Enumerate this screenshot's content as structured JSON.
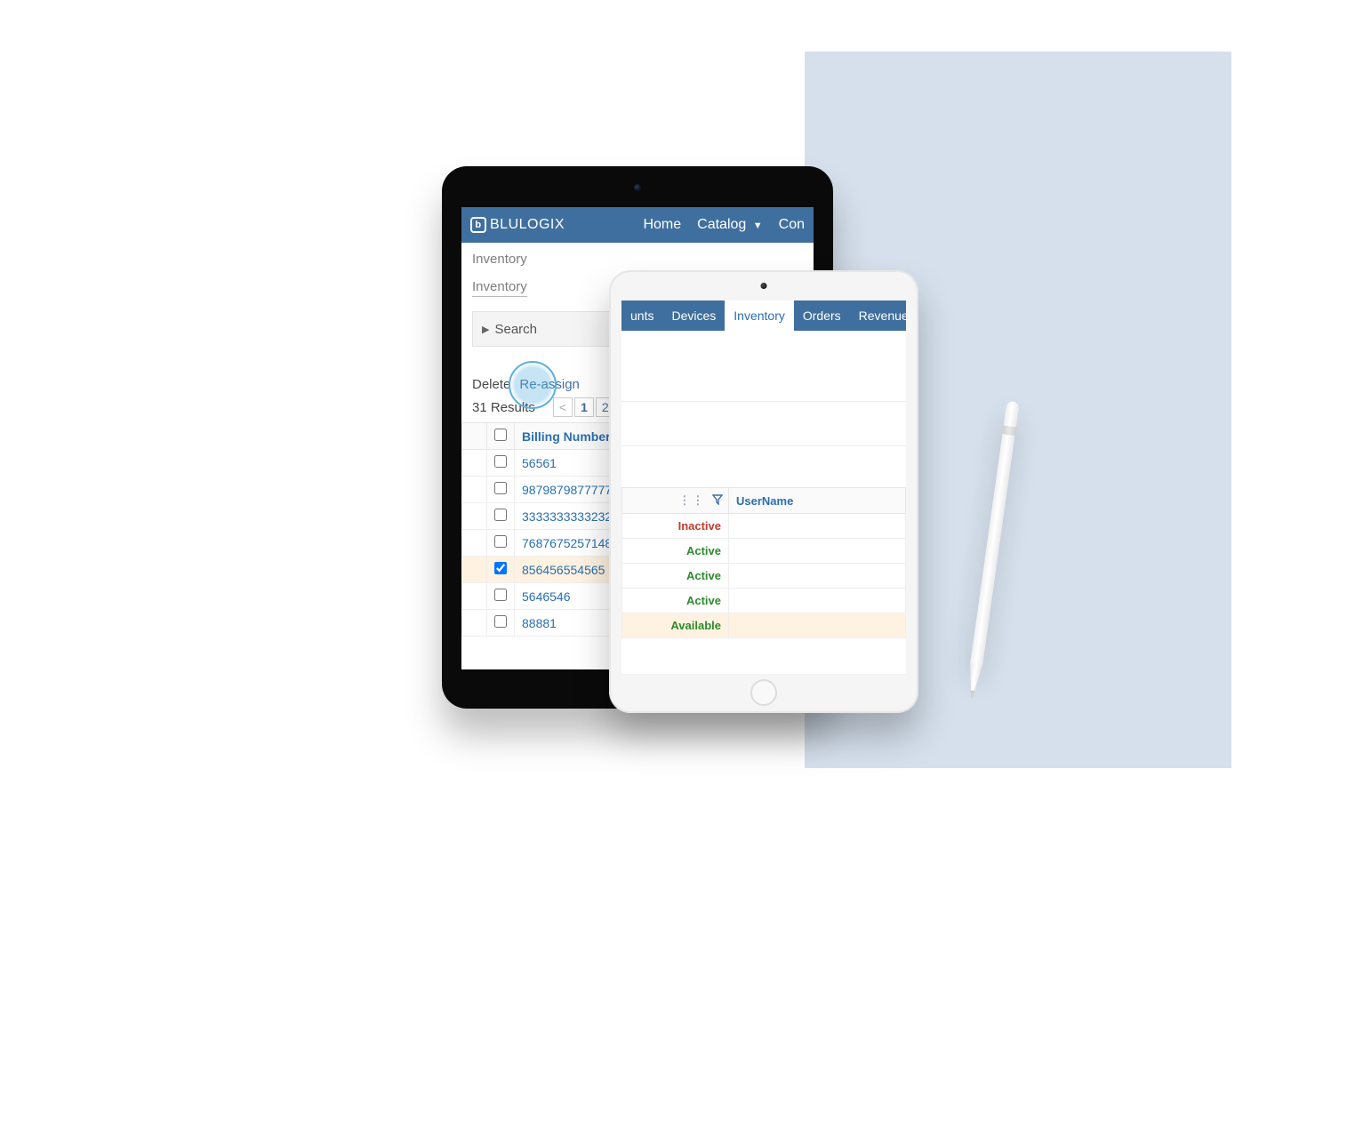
{
  "colors": {
    "navbar": "#3f6f9e",
    "link": "#2a6faf",
    "backdrop": "#d5e0ec",
    "highlight_ring": "#5bb0de",
    "row_highlight": "#fff2e1",
    "status_inactive": "#c23b2e",
    "status_active": "#2e8b2e"
  },
  "ipad_black": {
    "brand": "BLULOGIX",
    "nav": {
      "home": "Home",
      "catalog": "Catalog",
      "third_partial": "Con"
    },
    "breadcrumb1": "Inventory",
    "breadcrumb2": "Inventory",
    "search_label": "Search",
    "actions": {
      "delete": "Delete",
      "reassign": "Re-assign"
    },
    "results_text": "31 Results",
    "pager": {
      "prev": "<",
      "pages": [
        "1",
        "2"
      ]
    },
    "table": {
      "header": "Billing Number",
      "rows": [
        {
          "checked": false,
          "value": "56561"
        },
        {
          "checked": false,
          "value": "9879879877777"
        },
        {
          "checked": false,
          "value": "3333333333232"
        },
        {
          "checked": false,
          "value": "7687675257148"
        },
        {
          "checked": true,
          "value": "856456554565"
        },
        {
          "checked": false,
          "value": "5646546"
        },
        {
          "checked": false,
          "value": "88881"
        }
      ]
    }
  },
  "ipad_white": {
    "tabs": [
      {
        "label": "unts",
        "active": false
      },
      {
        "label": "Devices",
        "active": false
      },
      {
        "label": "Inventory",
        "active": true
      },
      {
        "label": "Orders",
        "active": false
      },
      {
        "label": "Revenue",
        "active": false,
        "dropdown": true
      }
    ],
    "table": {
      "username_header": "UserName",
      "rows": [
        {
          "status": "Inactive",
          "class": "st-inactive",
          "highlight": false
        },
        {
          "status": "Active",
          "class": "st-active",
          "highlight": false
        },
        {
          "status": "Active",
          "class": "st-active",
          "highlight": false
        },
        {
          "status": "Active",
          "class": "st-active",
          "highlight": false
        },
        {
          "status": "Available",
          "class": "st-available",
          "highlight": true
        }
      ]
    }
  }
}
